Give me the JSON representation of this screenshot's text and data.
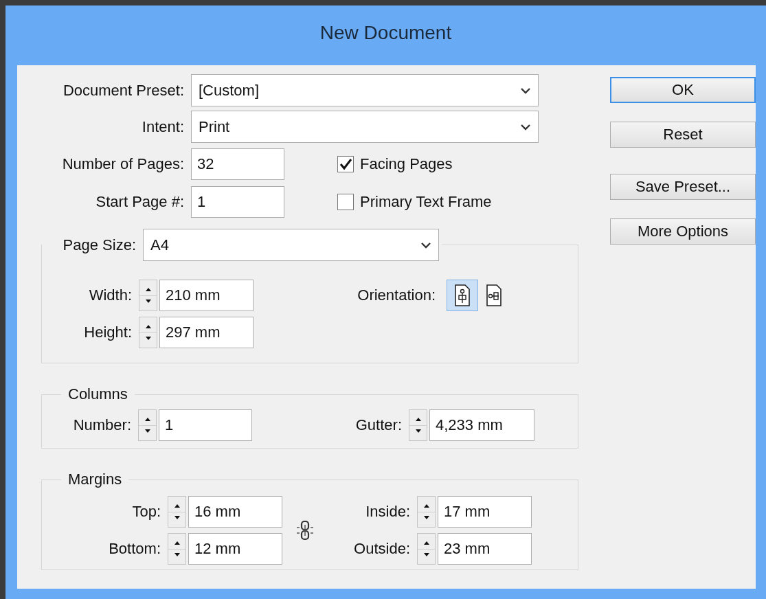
{
  "window": {
    "title": "New Document"
  },
  "preset": {
    "label": "Document Preset:",
    "value": "[Custom]"
  },
  "intent": {
    "label": "Intent:",
    "value": "Print"
  },
  "pages": {
    "label": "Number of Pages:",
    "value": "32"
  },
  "start_page": {
    "label": "Start Page #:",
    "value": "1"
  },
  "options": [
    {
      "label": "Facing Pages",
      "checked": true
    },
    {
      "label": "Primary Text Frame",
      "checked": false
    }
  ],
  "page_size": {
    "label": "Page Size:",
    "value": "A4",
    "width": {
      "label": "Width:",
      "value": "210 mm"
    },
    "height": {
      "label": "Height:",
      "value": "297 mm"
    },
    "orientation": {
      "label": "Orientation:",
      "choices": [
        {
          "kind": "portrait",
          "selected": true
        },
        {
          "kind": "landscape",
          "selected": false
        }
      ]
    }
  },
  "columns": {
    "title": "Columns",
    "number": {
      "label": "Number:",
      "value": "1"
    },
    "gutter": {
      "label": "Gutter:",
      "value": "4,233 mm"
    }
  },
  "margins": {
    "title": "Margins",
    "top": {
      "label": "Top:",
      "value": "16 mm"
    },
    "bottom": {
      "label": "Bottom:",
      "value": "12 mm"
    },
    "inside": {
      "label": "Inside:",
      "value": "17 mm"
    },
    "outside": {
      "label": "Outside:",
      "value": "23 mm"
    }
  },
  "buttons": [
    {
      "label": "OK",
      "default": true
    },
    {
      "label": "Reset",
      "default": false
    },
    {
      "label": "Save Preset...",
      "default": false
    },
    {
      "label": "More Options",
      "default": false
    }
  ]
}
